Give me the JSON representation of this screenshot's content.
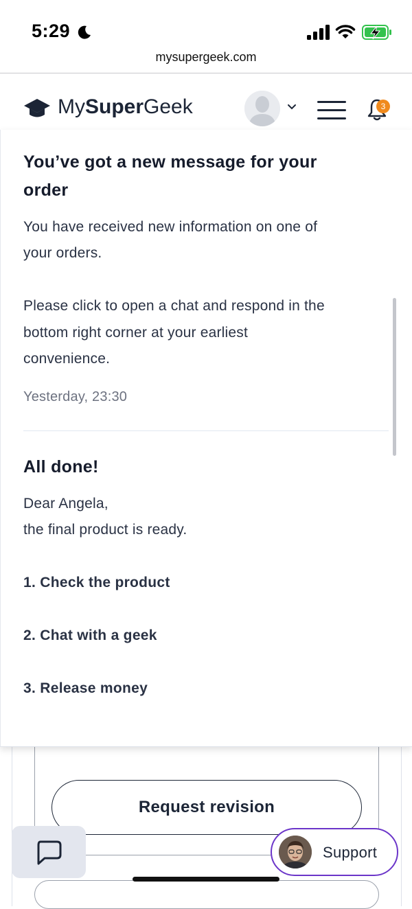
{
  "status_bar": {
    "time": "5:29"
  },
  "browser": {
    "url": "mysupergeek.com"
  },
  "header": {
    "logo_prefix": "My",
    "logo_bold": "Super",
    "logo_suffix": "Geek",
    "notification_count": "3"
  },
  "notifications": [
    {
      "title_line1": "You’ve got a new message for your",
      "title_line2": "order",
      "body_line1": "You have received new information on one of",
      "body_line2": "your orders.",
      "body_line3": "Please click to open a chat and respond in the",
      "body_line4": "bottom right corner at your earliest",
      "body_line5": "convenience.",
      "time": "Yesterday, 23:30"
    },
    {
      "title": "All done!",
      "body_line1": "Dear Angela,",
      "body_line2": "the final product is ready.",
      "steps": [
        "1. Check the product",
        "2. Chat with a geek",
        "3. Release money"
      ]
    }
  ],
  "page": {
    "request_revision_label": "Request revision"
  },
  "support": {
    "label": "Support"
  },
  "colors": {
    "accent_purple": "#6b35c9",
    "badge_orange": "#f08a1d",
    "text_dark": "#1c2536"
  }
}
